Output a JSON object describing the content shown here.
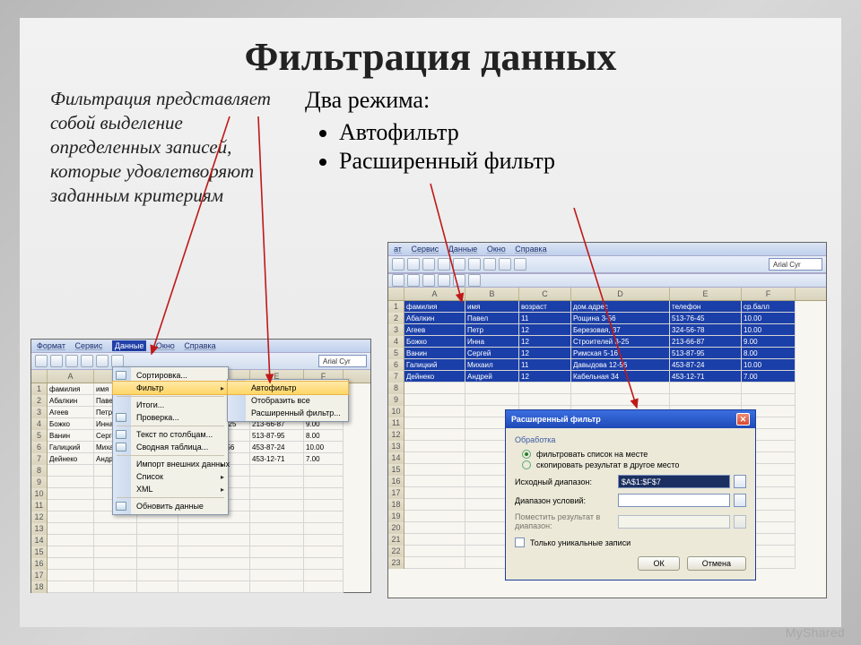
{
  "title": "Фильтрация данных",
  "description": "Фильтрация представляет собой выделение определенных записей, которые удовлетворяют заданным критериям",
  "modes": {
    "header": "Два режима:",
    "items": [
      "Автофильтр",
      "Расширенный фильтр"
    ]
  },
  "watermark": "MyShared",
  "excel": {
    "menubar": [
      "Формат",
      "Сервис",
      "Данные",
      "Окно",
      "Справка"
    ],
    "fontbox": "Arial Cyr",
    "cols": [
      "",
      "A",
      "B",
      "C",
      "D",
      "E",
      "F"
    ],
    "headerRow": [
      "фамилия",
      "имя",
      "возраст",
      "дом.адрес",
      "телефон",
      "ср.балл"
    ],
    "rows": [
      [
        "Абалкин",
        "Павел",
        "11",
        "Рощина 3-56",
        "513-76-45",
        "10.00"
      ],
      [
        "Агеев",
        "Петр",
        "12",
        "Березовая, 37",
        "324-56-78",
        "10.00"
      ],
      [
        "Божко",
        "Инна",
        "12",
        "Строителей 3-25",
        "213-66-87",
        "9.00"
      ],
      [
        "Ванин",
        "Сергей",
        "12",
        "Римская 5-16",
        "513-87-95",
        "8.00"
      ],
      [
        "Галицкий",
        "Михаил",
        "11",
        "Давыдова 12-56",
        "453-87-24",
        "10.00"
      ],
      [
        "Дейнеко",
        "Андрей",
        "12",
        "Кабельная 34",
        "453-12-71",
        "7.00"
      ]
    ],
    "ctxmenu_main": [
      {
        "label": "Сортировка...",
        "icon": true
      },
      {
        "label": "Фильтр",
        "selected": true,
        "arrow": true
      },
      {
        "sep": true
      },
      {
        "label": "Итоги..."
      },
      {
        "label": "Проверка...",
        "icon": true
      },
      {
        "sep": true
      },
      {
        "label": "Текст по столбцам...",
        "icon": true
      },
      {
        "label": "Сводная таблица...",
        "icon": true
      },
      {
        "sep": true
      },
      {
        "label": "Импорт внешних данных",
        "arrow": true
      },
      {
        "label": "Список",
        "arrow": true
      },
      {
        "label": "XML",
        "arrow": true
      },
      {
        "sep": true
      },
      {
        "label": "Обновить данные",
        "icon": true
      }
    ],
    "ctxmenu_sub": [
      {
        "label": "Автофильтр",
        "selected": true
      },
      {
        "label": "Отобразить все"
      },
      {
        "label": "Расширенный фильтр..."
      }
    ]
  },
  "dialog": {
    "title": "Расширенный фильтр",
    "group": "Обработка",
    "radio1": "фильтровать список на месте",
    "radio2": "скопировать результат в другое место",
    "label_src": "Исходный диапазон:",
    "value_src": "$A$1:$F$7",
    "label_cond": "Диапазон условий:",
    "label_dest": "Поместить результат в диапазон:",
    "check": "Только уникальные записи",
    "ok": "ОК",
    "cancel": "Отмена"
  }
}
